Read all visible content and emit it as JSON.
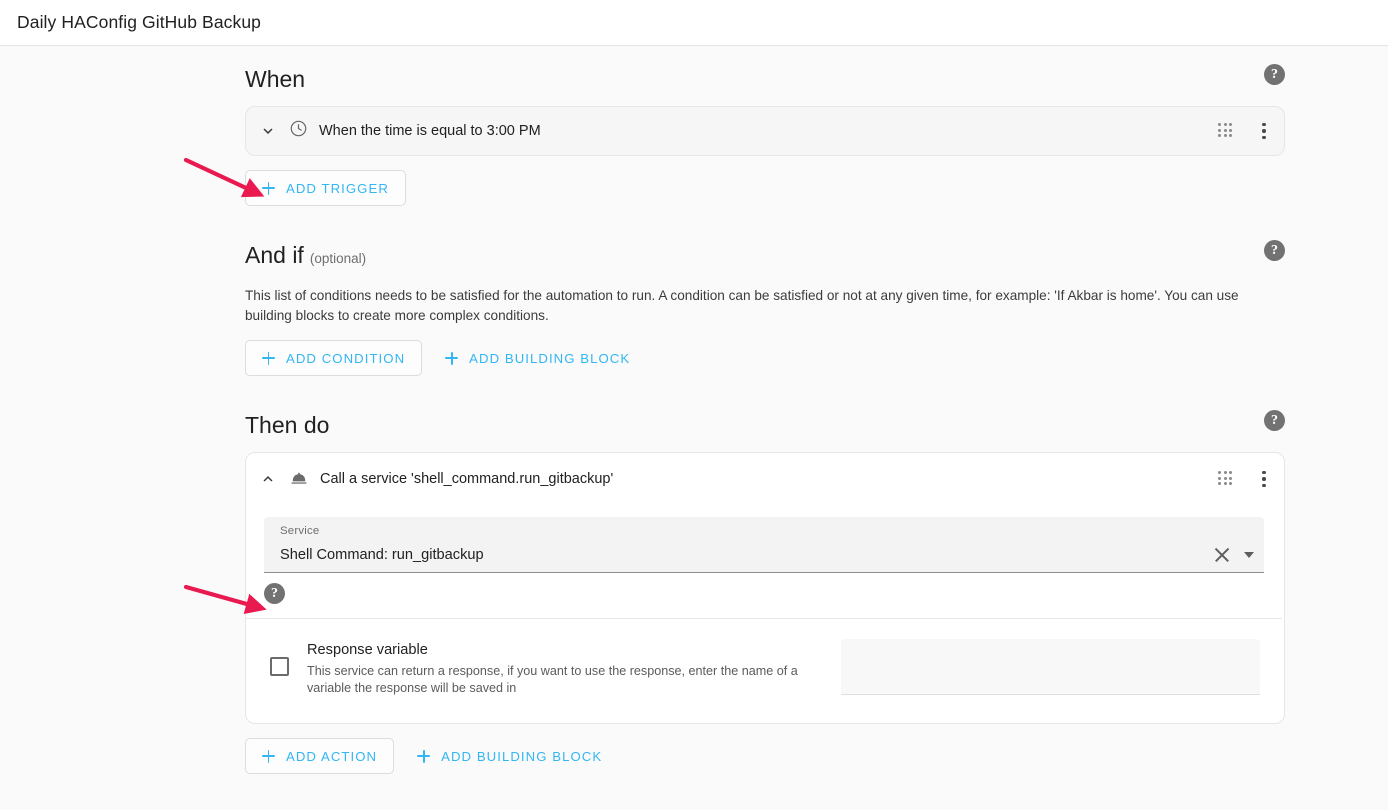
{
  "toolbar": {
    "title": "Daily HAConfig GitHub Backup"
  },
  "colors": {
    "accent": "#32b7f4",
    "annotation_arrow": "#e81a4f",
    "help_icon_bg": "#727272",
    "page_background": "#fafafa"
  },
  "sections": {
    "when": {
      "title": "When",
      "help_icon": "help-circle-icon",
      "trigger": {
        "expand_icon": "chevron-down-icon",
        "type_icon": "clock-icon",
        "label": "When the time is equal to 3:00 PM",
        "drag_icon": "drag-grid-icon",
        "menu_icon": "overflow-menu-icon"
      },
      "add_trigger_button": "ADD TRIGGER"
    },
    "and_if": {
      "title": "And if",
      "optional": "(optional)",
      "help_icon": "help-circle-icon",
      "description": "This list of conditions needs to be satisfied for the automation to run. A condition can be satisfied or not at any given time, for example: 'If Akbar is home'. You can use building blocks to create more complex conditions.",
      "add_condition_button": "ADD CONDITION",
      "add_building_block_button": "ADD BUILDING BLOCK"
    },
    "then_do": {
      "title": "Then do",
      "help_icon": "help-circle-icon",
      "action": {
        "expand_icon": "chevron-up-icon",
        "type_icon": "service-bell-icon",
        "label": "Call a service 'shell_command.run_gitbackup'",
        "drag_icon": "drag-grid-icon",
        "menu_icon": "overflow-menu-icon",
        "service_field": {
          "label": "Service",
          "value": "Shell Command: run_gitbackup",
          "clear_icon": "close-x-icon",
          "dropdown_icon": "caret-down-icon"
        },
        "field_help_icon": "help-circle-icon",
        "response_variable": {
          "checkbox": "unchecked",
          "title": "Response variable",
          "description": "This service can return a response, if you want to use the response, enter the name of a variable the response will be saved in",
          "input_value": "",
          "input_placeholder": ""
        }
      },
      "add_action_button": "ADD ACTION",
      "add_building_block_button": "ADD BUILDING BLOCK"
    }
  },
  "annotations": [
    {
      "name": "arrow-to-trigger-chevron",
      "target": "trigger expand chevron"
    },
    {
      "name": "arrow-to-service-field",
      "target": "service field value"
    }
  ]
}
